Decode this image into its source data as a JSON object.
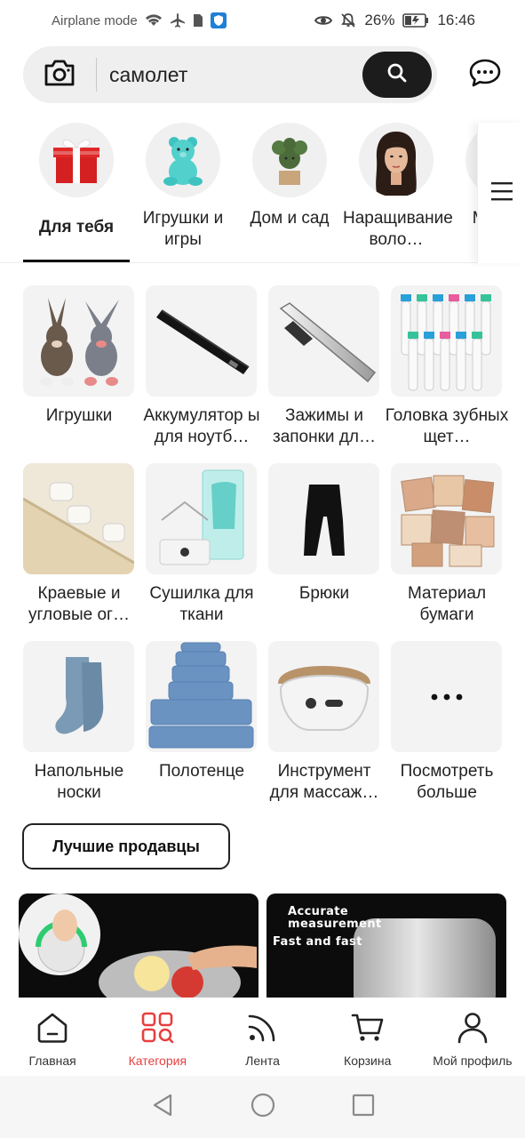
{
  "status_bar": {
    "left_text": "Airplane mode",
    "battery": "26%",
    "time": "16:46"
  },
  "search": {
    "value": "самолет",
    "camera_icon": "camera-icon",
    "search_icon": "search-icon",
    "chat_icon": "chat-icon"
  },
  "categories": [
    {
      "label": "Для тебя",
      "icon": "gift-icon",
      "active": true
    },
    {
      "label": "Игрушки и игры",
      "icon": "teddy-bear-icon"
    },
    {
      "label": "Дом и сад",
      "icon": "cactus-icon"
    },
    {
      "label": "Наращивание воло…",
      "icon": "hair-extension-icon"
    },
    {
      "label": "М… с…",
      "icon": "partial-category-icon"
    }
  ],
  "products": [
    {
      "label": "Игрушки"
    },
    {
      "label": "Аккумулятор ы для ноутб…"
    },
    {
      "label": "Зажимы и запонки дл…"
    },
    {
      "label": "Головка зубных щет…"
    },
    {
      "label": "Краевые и угловые ог…"
    },
    {
      "label": "Сушилка для ткани"
    },
    {
      "label": "Брюки"
    },
    {
      "label": "Материал бумаги"
    },
    {
      "label": "Напольные носки"
    },
    {
      "label": "Полотенце"
    },
    {
      "label": "Инструмент для массаж…"
    },
    {
      "label": "Посмотреть больше"
    }
  ],
  "best_sellers": "Лучшие продавцы",
  "banners": {
    "right_line1": "Accurate measurement",
    "right_line2": "Fast and fast"
  },
  "bottom_nav": [
    {
      "label": "Главная",
      "icon": "home-icon"
    },
    {
      "label": "Категория",
      "icon": "category-icon",
      "active": true
    },
    {
      "label": "Лента",
      "icon": "feed-icon"
    },
    {
      "label": "Корзина",
      "icon": "cart-icon"
    },
    {
      "label": "Мой профиль",
      "icon": "profile-icon"
    }
  ],
  "colors": {
    "accent": "#e83e3e",
    "dark": "#1c1c1c",
    "search_bg": "#efefef"
  }
}
